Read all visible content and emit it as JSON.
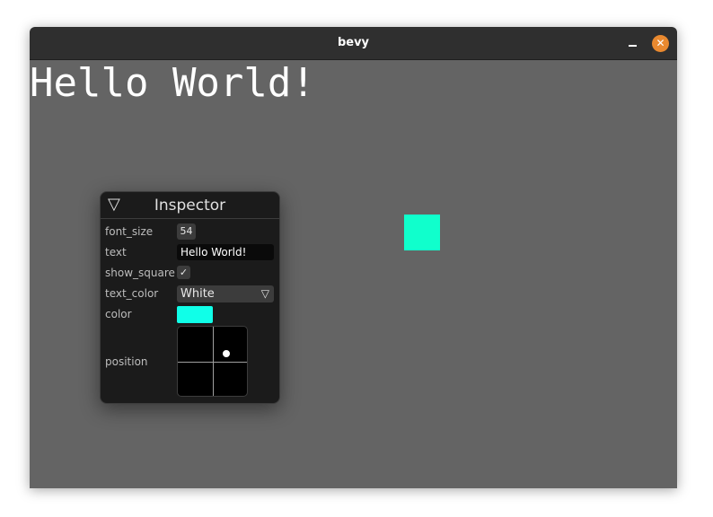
{
  "window": {
    "title": "bevy",
    "minimize_icon": "minimize-icon",
    "close_icon": "close-icon",
    "close_glyph": "✕"
  },
  "scene": {
    "text": "Hello World!",
    "square_color": "#10ffcc",
    "background_color": "#646464"
  },
  "inspector": {
    "title": "Inspector",
    "collapse_glyph": "▽",
    "fields": {
      "font_size": {
        "label": "font_size",
        "value": "54"
      },
      "text": {
        "label": "text",
        "value": "Hello World!"
      },
      "show_square": {
        "label": "show_square",
        "checked": true,
        "glyph": "✓"
      },
      "text_color": {
        "label": "text_color",
        "value": "White",
        "arrow": "▽"
      },
      "color": {
        "label": "color",
        "value": "#10ffe8"
      },
      "position": {
        "label": "position"
      }
    }
  }
}
